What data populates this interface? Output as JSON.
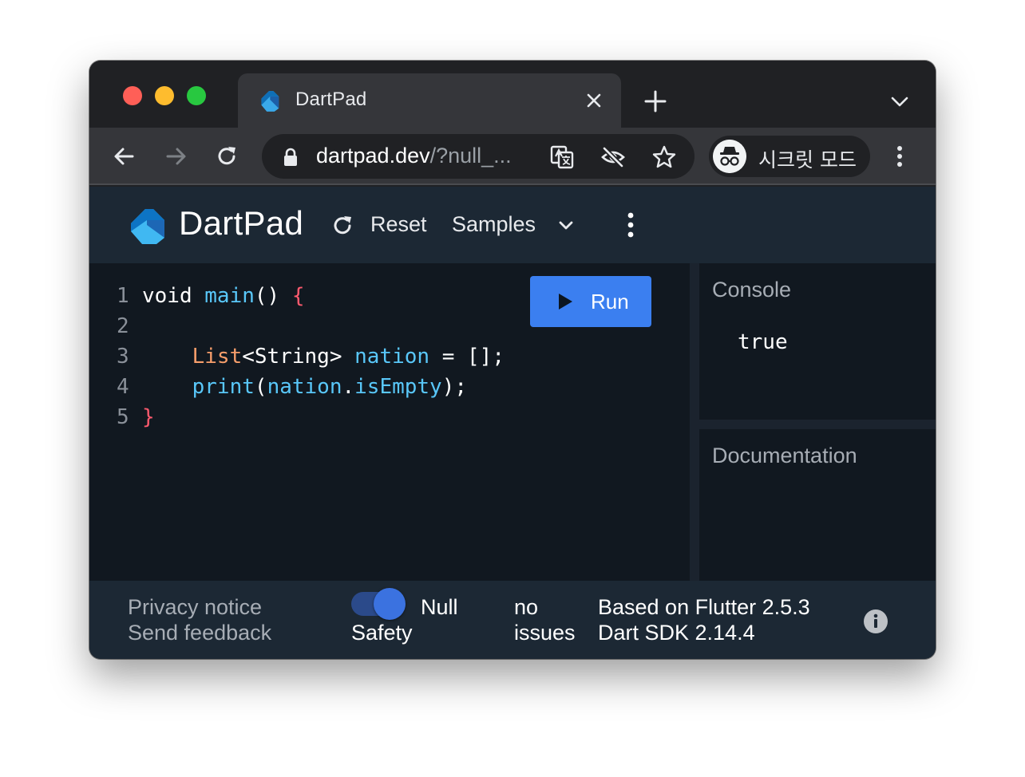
{
  "browser": {
    "tab_title": "DartPad",
    "url_host": "dartpad.dev",
    "url_path": "/?null_...",
    "incognito_label": "시크릿 모드",
    "icons": [
      "back-arrow-icon",
      "forward-arrow-icon",
      "reload-icon",
      "lock-icon",
      "translate-icon",
      "tracking-blocked-eye-icon",
      "bookmark-star-icon",
      "incognito-icon",
      "kebab-menu-icon",
      "close-icon",
      "plus-icon",
      "chevron-down-icon"
    ]
  },
  "app": {
    "title": "DartPad",
    "reset_label": "Reset",
    "samples_label": "Samples",
    "run_label": "Run",
    "accent_color": "#3b7ff0"
  },
  "editor": {
    "lines": [
      {
        "num": "1",
        "tokens": [
          [
            "kw",
            "void "
          ],
          [
            "fn",
            "main"
          ],
          [
            "p",
            "() "
          ],
          [
            "brace",
            "{"
          ]
        ]
      },
      {
        "num": "2",
        "tokens": []
      },
      {
        "num": "3",
        "tokens": [
          [
            "p",
            "    "
          ],
          [
            "type",
            "List"
          ],
          [
            "p",
            "<String> "
          ],
          [
            "fn",
            "nation"
          ],
          [
            "p",
            " = [];"
          ]
        ]
      },
      {
        "num": "4",
        "tokens": [
          [
            "p",
            "    "
          ],
          [
            "fn",
            "print"
          ],
          [
            "p",
            "("
          ],
          [
            "fn",
            "nation"
          ],
          [
            "p",
            "."
          ],
          [
            "fn",
            "isEmpty"
          ],
          [
            "p",
            ");"
          ]
        ]
      },
      {
        "num": "5",
        "tokens": [
          [
            "brace",
            "}"
          ]
        ]
      }
    ]
  },
  "console": {
    "title": "Console",
    "output": "true"
  },
  "documentation": {
    "title": "Documentation"
  },
  "footer": {
    "privacy": "Privacy notice",
    "feedback": "Send feedback",
    "null_safety_line1": "Null",
    "null_safety_line2": "Safety",
    "null_safety_enabled": true,
    "issues_line1": "no",
    "issues_line2": "issues",
    "flutter_version": "Based on Flutter 2.5.3",
    "dart_sdk": "Dart SDK 2.14.4"
  }
}
